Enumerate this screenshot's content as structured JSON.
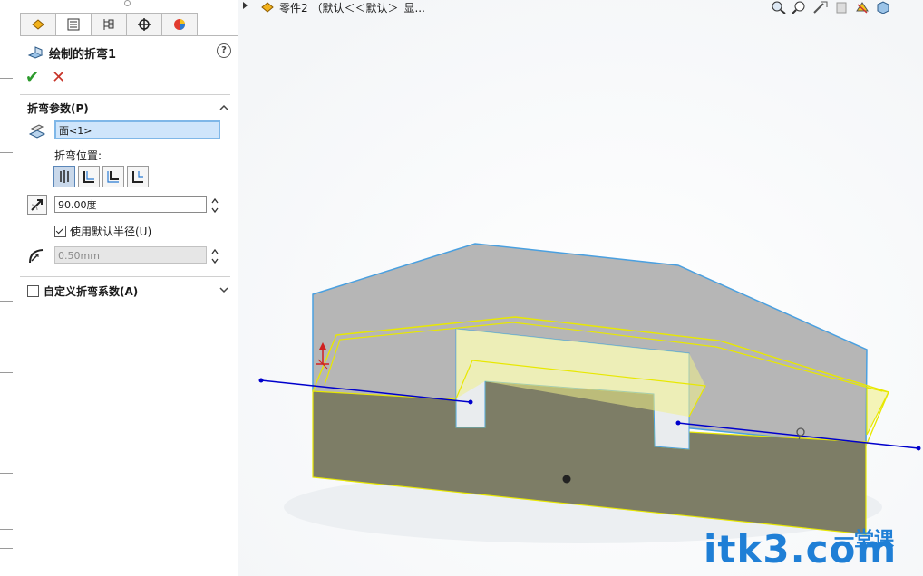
{
  "breadcrumb": {
    "text": "零件2 （默认＜＜默认＞_显..."
  },
  "panel": {
    "feature_title": "绘制的折弯1",
    "help_glyph": "?",
    "ok_glyph": "✔",
    "cancel_glyph": "✕",
    "section_bend": {
      "header": "折弯参数(P)",
      "face_value": "面<1>",
      "bend_position_label": "折弯位置:",
      "angle_value": "90.00度",
      "use_default_radius_label": "使用默认半径(U)",
      "use_default_radius_checked": true,
      "radius_value": "0.50mm"
    },
    "section_custom": {
      "header": "自定义折弯系数(A)",
      "checked": false
    }
  },
  "tabs": [
    "feature-manager",
    "property-manager",
    "configuration-manager",
    "dim-xpert",
    "display-manager"
  ],
  "watermark": {
    "main": "itk3.com",
    "sub": "一堂课"
  },
  "colors": {
    "model_upper": "#b5b5b5",
    "model_lower": "#7d7d66",
    "sketch_line": "#e8e800",
    "bend_line": "#0000cc",
    "edge_highlight": "#4aa0e0",
    "watermark": "#1f7fd6"
  }
}
